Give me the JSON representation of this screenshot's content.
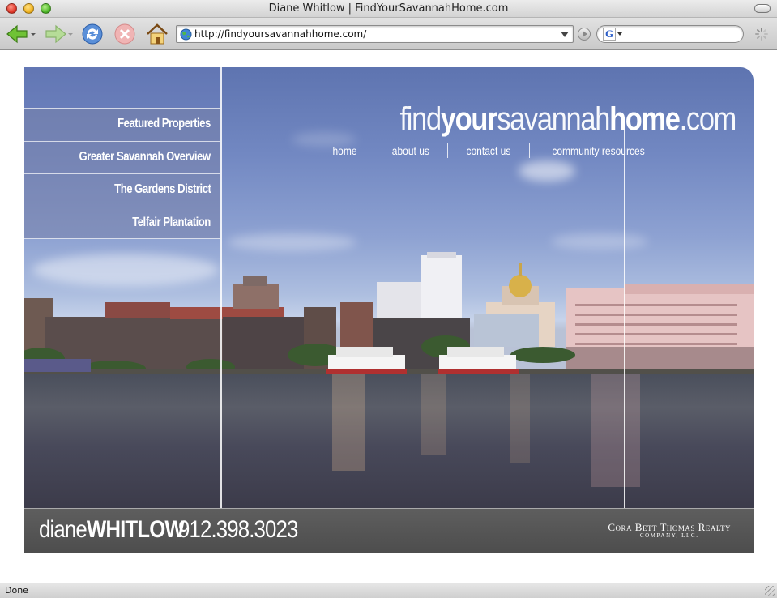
{
  "window": {
    "title": "Diane Whitlow | FindYourSavannahHome.com"
  },
  "toolbar": {
    "url": "http://findyoursavannahhome.com/",
    "icons": [
      "back-icon",
      "forward-icon",
      "reload-icon",
      "stop-icon",
      "home-icon",
      "globe-icon",
      "go-icon",
      "google-search-icon",
      "loading-spinner-icon"
    ]
  },
  "site": {
    "logo": {
      "part1": "find",
      "part2": "your",
      "part3": "savannah",
      "part4": "home",
      "part5": ".com"
    },
    "nav": [
      {
        "label": "home"
      },
      {
        "label": "about us"
      },
      {
        "label": "contact us"
      },
      {
        "label": "community resources"
      }
    ],
    "menu": [
      {
        "label": "Featured Properties"
      },
      {
        "label": "Greater Savannah Overview"
      },
      {
        "label": "The Gardens District"
      },
      {
        "label": "Telfair Plantation"
      }
    ],
    "footer": {
      "agent_first": "diane",
      "agent_last": "WHITLOW",
      "phone": "912.398.3023",
      "brokerage": "Cora Bett Thomas Realty",
      "brokerage_sub": "COMPANY, LLC."
    }
  },
  "status": {
    "text": "Done"
  },
  "colors": {
    "sky_top": "#5e74b0",
    "footer_bar": "#555555",
    "menu_overlay": "#7882aa"
  }
}
